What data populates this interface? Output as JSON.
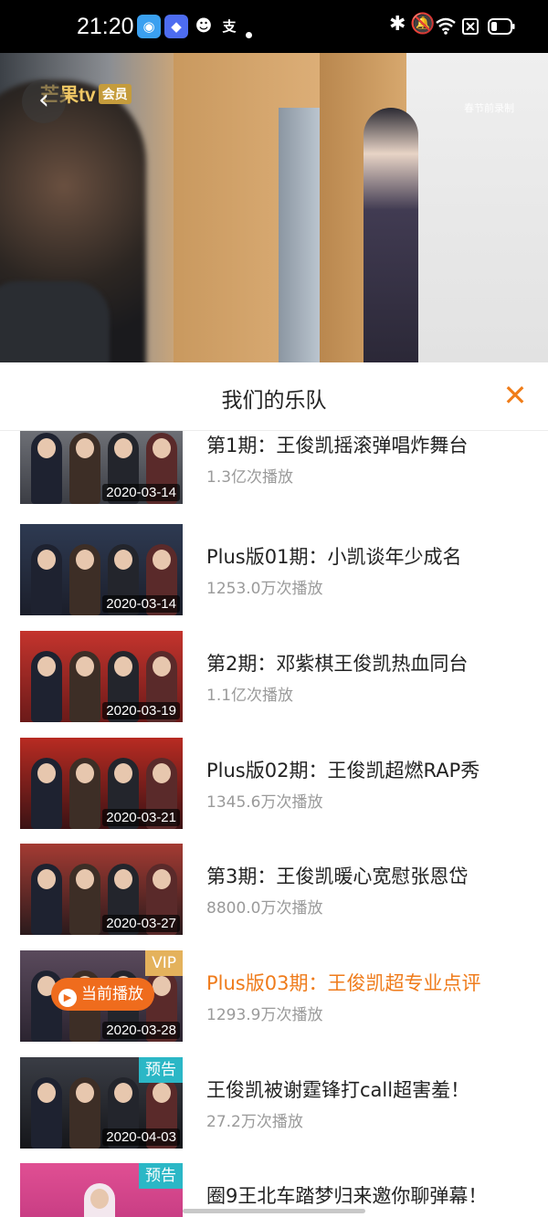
{
  "status_bar": {
    "time": "21:20",
    "app_icons": [
      "qq-icon",
      "feishu-icon",
      "wechat-icon",
      "alipay-icon"
    ],
    "right_icons": [
      "bluetooth-icon",
      "mute-bell-icon",
      "wifi-icon",
      "x-icon",
      "battery-icon"
    ]
  },
  "player": {
    "logo_text": "芒果tv",
    "logo_badge": "会员",
    "watermark": "春节前录制"
  },
  "panel": {
    "title": "我们的乐队",
    "close_glyph": "✕"
  },
  "episodes": [
    {
      "title": "第1期：王俊凯摇滚弹唱炸舞台",
      "plays": "1.3亿次播放",
      "date": "2020-03-14",
      "tag": "",
      "current": false,
      "art": "stage-grey"
    },
    {
      "title": "Plus版01期：小凯谈年少成名",
      "plays": "1253.0万次播放",
      "date": "2020-03-14",
      "tag": "",
      "current": false,
      "art": "stage-navy"
    },
    {
      "title": "第2期：邓紫棋王俊凯热血同台",
      "plays": "1.1亿次播放",
      "date": "2020-03-19",
      "tag": "",
      "current": false,
      "art": "stage-red"
    },
    {
      "title": "Plus版02期：王俊凯超燃RAP秀",
      "plays": "1345.6万次播放",
      "date": "2020-03-21",
      "tag": "",
      "current": false,
      "art": "stage-crimson"
    },
    {
      "title": "第3期：王俊凯暖心宽慰张恩岱",
      "plays": "8800.0万次播放",
      "date": "2020-03-27",
      "tag": "",
      "current": false,
      "art": "stage-maroon"
    },
    {
      "title": "Plus版03期：王俊凯超专业点评",
      "plays": "1293.9万次播放",
      "date": "2020-03-28",
      "tag": "VIP",
      "current": true,
      "art": "stage-dark"
    },
    {
      "title": "王俊凯被谢霆锋打call超害羞！",
      "plays": "27.2万次播放",
      "date": "2020-04-03",
      "tag": "预告",
      "current": false,
      "art": "stage-black"
    },
    {
      "title": "圈9王北车踏梦归来邀你聊弹幕！",
      "plays": "",
      "date": "",
      "tag": "预告",
      "current": false,
      "art": "stage-pink"
    }
  ],
  "now_playing_label": "当前播放",
  "colors": {
    "accent": "#ef7b1b",
    "vip": "#e4b25c",
    "preview": "#2bb7c6"
  }
}
